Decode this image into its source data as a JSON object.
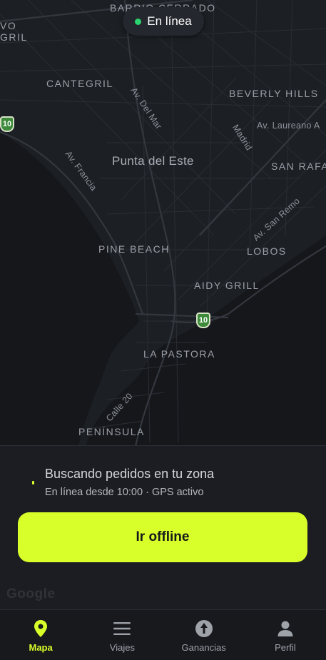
{
  "status": {
    "label": "En línea"
  },
  "map": {
    "labels": {
      "barrio_cerrado": "BARRIO CERRADO",
      "vo": "VO",
      "gril": "GRIL",
      "cantegril": "CANTEGRIL",
      "av_del_mar": "Av. Del Mar",
      "beverly_hills": "BEVERLY HILLS",
      "madrid": "Madrid",
      "av_laureano": "Av. Laureano A",
      "punta_del_este": "Punta del Este",
      "av_francia": "Av. Francia",
      "san_rafael": "SAN RAFA",
      "av_san_remo": "Av. San Remo",
      "pine_beach": "PINE BEACH",
      "lobos": "LOBOS",
      "aidy_grill": "AIDY GRILL",
      "la_pastora": "LA PASTORA",
      "calle_20": "Calle 20",
      "peninsula": "PENÍNSULA"
    },
    "route_shields": [
      "10",
      "10"
    ],
    "attribution": "Google"
  },
  "panel": {
    "title": "Buscando pedidos en tu zona",
    "subtitle": "En línea desde 10:00 · GPS activo",
    "button_label": "Ir offline"
  },
  "tabs": [
    {
      "label": "Mapa",
      "icon": "map-pin-icon",
      "active": true
    },
    {
      "label": "Viajes",
      "icon": "list-icon",
      "active": false
    },
    {
      "label": "Ganancias",
      "icon": "earnings-icon",
      "active": false
    },
    {
      "label": "Perfil",
      "icon": "person-icon",
      "active": false
    }
  ],
  "colors": {
    "accent": "#d8ff2a",
    "online": "#2bd46f",
    "background": "#1b1d22",
    "water": "#15171b",
    "land": "#1e2126"
  }
}
